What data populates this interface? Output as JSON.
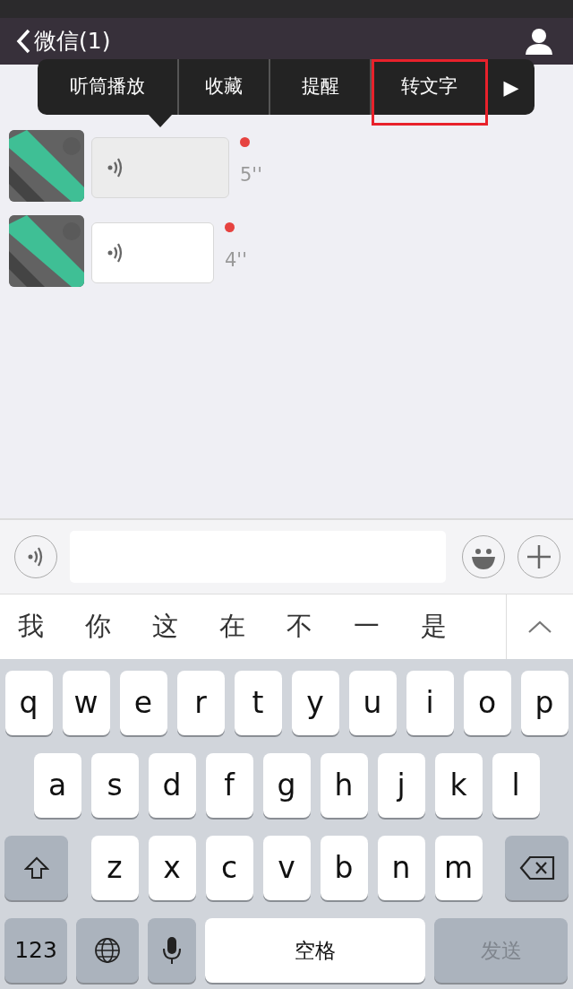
{
  "nav": {
    "back_label": "微信(1)"
  },
  "menu": {
    "items": [
      {
        "label": "听筒播放",
        "highlighted": false
      },
      {
        "label": "收藏",
        "highlighted": false
      },
      {
        "label": "提醒",
        "highlighted": false
      },
      {
        "label": "转文字",
        "highlighted": true
      }
    ],
    "more": "▶"
  },
  "messages": [
    {
      "duration": "5''",
      "unread": true,
      "selected": true
    },
    {
      "duration": "4''",
      "unread": true,
      "selected": false
    }
  ],
  "candidates": [
    "我",
    "你",
    "这",
    "在",
    "不",
    "一",
    "是"
  ],
  "keyboard": {
    "rows": [
      {
        "keys": [
          {
            "kind": "letter",
            "label": "q"
          },
          {
            "kind": "letter",
            "label": "w"
          },
          {
            "kind": "letter",
            "label": "e"
          },
          {
            "kind": "letter",
            "label": "r"
          },
          {
            "kind": "letter",
            "label": "t"
          },
          {
            "kind": "letter",
            "label": "y"
          },
          {
            "kind": "letter",
            "label": "u"
          },
          {
            "kind": "letter",
            "label": "i"
          },
          {
            "kind": "letter",
            "label": "o"
          },
          {
            "kind": "letter",
            "label": "p"
          }
        ]
      },
      {
        "keys": [
          {
            "kind": "letter",
            "label": "a"
          },
          {
            "kind": "letter",
            "label": "s"
          },
          {
            "kind": "letter",
            "label": "d"
          },
          {
            "kind": "letter",
            "label": "f"
          },
          {
            "kind": "letter",
            "label": "g"
          },
          {
            "kind": "letter",
            "label": "h"
          },
          {
            "kind": "letter",
            "label": "j"
          },
          {
            "kind": "letter",
            "label": "k"
          },
          {
            "kind": "letter",
            "label": "l"
          }
        ]
      },
      {
        "keys": [
          {
            "kind": "shift"
          },
          {
            "kind": "letter",
            "label": "z"
          },
          {
            "kind": "letter",
            "label": "x"
          },
          {
            "kind": "letter",
            "label": "c"
          },
          {
            "kind": "letter",
            "label": "v"
          },
          {
            "kind": "letter",
            "label": "b"
          },
          {
            "kind": "letter",
            "label": "n"
          },
          {
            "kind": "letter",
            "label": "m"
          },
          {
            "kind": "delete"
          }
        ]
      },
      {
        "keys": [
          {
            "kind": "numbers",
            "label": "123"
          },
          {
            "kind": "globe"
          },
          {
            "kind": "mic"
          },
          {
            "kind": "space",
            "label": "空格"
          },
          {
            "kind": "send",
            "label": "发送",
            "disabled": true
          }
        ]
      }
    ]
  }
}
